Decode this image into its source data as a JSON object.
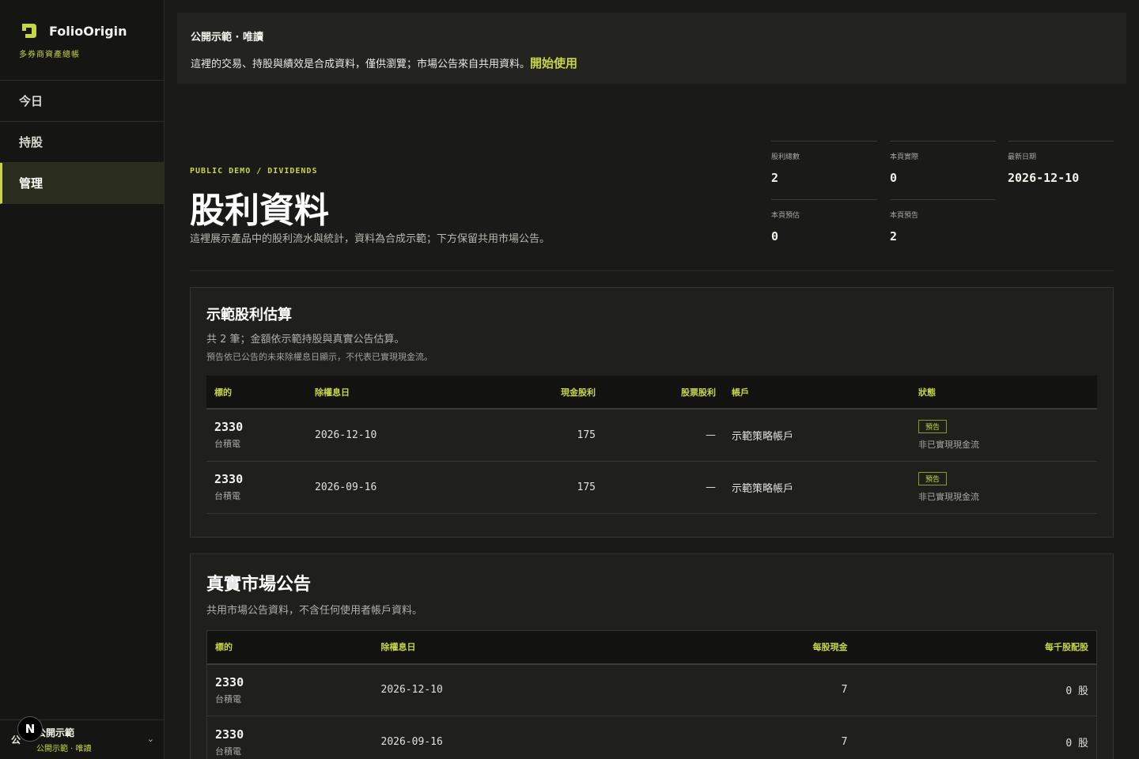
{
  "brand": {
    "name": "FolioOrigin",
    "subtitle": "多券商資產總帳"
  },
  "nav": [
    {
      "label": "今日"
    },
    {
      "label": "持股"
    },
    {
      "label": "管理"
    }
  ],
  "footer": {
    "avatar": "公",
    "title": "公開示範",
    "subtitle": "公開示範 · 唯讀",
    "badge": "N"
  },
  "banner": {
    "title": "公開示範 · 唯讀",
    "text": "這裡的交易、持股與績效是合成資料，僅供瀏覽；市場公告來自共用資料。",
    "link": "開始使用"
  },
  "hero": {
    "eyebrow": "PUBLIC DEMO / DIVIDENDS",
    "title": "股利資料",
    "description": "這裡展示產品中的股利流水與統計，資料為合成示範；下方保留共用市場公告。"
  },
  "stats": [
    {
      "label": "股利總數",
      "value": "2"
    },
    {
      "label": "本頁實際",
      "value": "0"
    },
    {
      "label": "最新日期",
      "value": "2026-12-10"
    },
    {
      "label": "本頁預估",
      "value": "0"
    },
    {
      "label": "本頁預告",
      "value": "2"
    }
  ],
  "estimate": {
    "title": "示範股利估算",
    "subtitle": "共 2 筆；金額依示範持股與真實公告估算。",
    "note": "預告依已公告的未來除權息日顯示，不代表已實現現金流。",
    "columns": [
      "標的",
      "除權息日",
      "現金股利",
      "股票股利",
      "帳戶",
      "狀態"
    ],
    "rows": [
      {
        "symbol": "2330",
        "name": "台積電",
        "date": "2026-12-10",
        "cash": "175",
        "stock": "—",
        "account": "示範策略帳戶",
        "status": "預告",
        "status_note": "非已實現現金流"
      },
      {
        "symbol": "2330",
        "name": "台積電",
        "date": "2026-09-16",
        "cash": "175",
        "stock": "—",
        "account": "示範策略帳戶",
        "status": "預告",
        "status_note": "非已實現現金流"
      }
    ]
  },
  "market": {
    "title": "真實市場公告",
    "subtitle": "共用市場公告資料，不含任何使用者帳戶資料。",
    "columns": [
      "標的",
      "除權息日",
      "每股現金",
      "每千股配股"
    ],
    "rows": [
      {
        "symbol": "2330",
        "name": "台積電",
        "date": "2026-12-10",
        "cash": "7",
        "stock": "0 股"
      },
      {
        "symbol": "2330",
        "name": "台積電",
        "date": "2026-09-16",
        "cash": "7",
        "stock": "0 股"
      }
    ]
  },
  "colors": {
    "accent": "#c6d647",
    "background": "#1a1a18",
    "sidebar": "#151613"
  }
}
